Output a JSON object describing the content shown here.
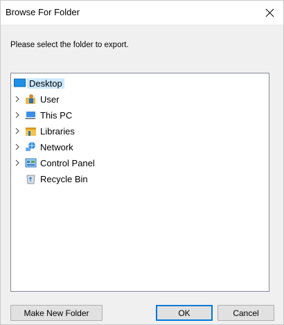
{
  "window": {
    "title": "Browse For Folder"
  },
  "prompt": "Please select the folder to export.",
  "tree": {
    "items": [
      {
        "label": "Desktop",
        "icon": "desktop-icon",
        "selected": true,
        "expandable": false
      },
      {
        "label": "User",
        "icon": "user-folder-icon",
        "expandable": true
      },
      {
        "label": "This PC",
        "icon": "computer-icon",
        "expandable": true
      },
      {
        "label": "Libraries",
        "icon": "libraries-icon",
        "expandable": true
      },
      {
        "label": "Network",
        "icon": "network-icon",
        "expandable": true
      },
      {
        "label": "Control Panel",
        "icon": "control-panel-icon",
        "expandable": true
      },
      {
        "label": "Recycle Bin",
        "icon": "recycle-bin-icon",
        "expandable": false
      }
    ]
  },
  "buttons": {
    "new_folder": "Make New Folder",
    "ok": "OK",
    "cancel": "Cancel"
  },
  "colors": {
    "selection": "#cce8ff",
    "accent": "#0078d7"
  }
}
